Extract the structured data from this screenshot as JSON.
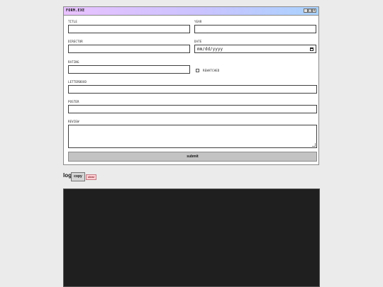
{
  "window": {
    "title": "FORM.EXE",
    "buttons": [
      "_",
      "□",
      "x"
    ]
  },
  "form": {
    "title_label": "TITLE",
    "year_label": "YEAR",
    "director_label": "DIRECTOR",
    "date_label": "DATE",
    "date_placeholder": "mm/dd/yyyy",
    "rating_label": "RATING",
    "rewatched_label": "REWATCHED",
    "letterboxd_label": "LETTERBOXD",
    "poster_label": "POSTER",
    "review_label": "REVIEW",
    "submit_label": "submit"
  },
  "log": {
    "label": "log",
    "copy_label": "copy",
    "clear_label": "clear"
  }
}
